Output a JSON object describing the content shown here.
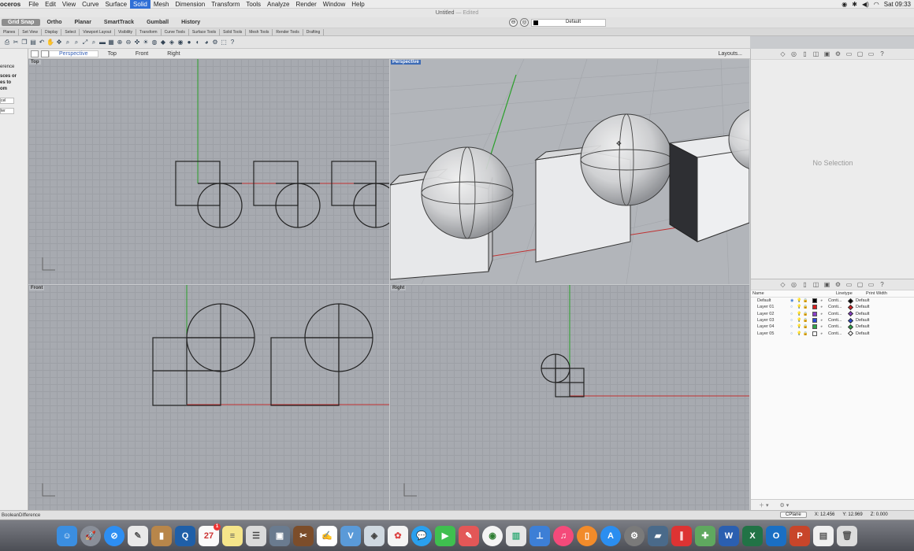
{
  "menubar": {
    "app": "oceros",
    "items": [
      "File",
      "Edit",
      "View",
      "Curve",
      "Surface",
      "Solid",
      "Mesh",
      "Dimension",
      "Transform",
      "Tools",
      "Analyze",
      "Render",
      "Window",
      "Help"
    ],
    "active_item": "Solid",
    "clock": "Sat 09:33"
  },
  "title": {
    "name": "Untitled",
    "status": "— Edited"
  },
  "snapbar": {
    "toggles": [
      "Grid Snap",
      "Ortho",
      "Planar",
      "SmartTrack",
      "Gumball",
      "History"
    ],
    "active_toggle": "Grid Snap",
    "layer": "Default"
  },
  "tabbar": {
    "tabs": [
      "Planes",
      "Set View",
      "Display",
      "Select",
      "Viewport Layout",
      "Visibility",
      "Transform",
      "Curve Tools",
      "Surface Tools",
      "Solid Tools",
      "Mesh Tools",
      "Render Tools",
      "Drafting"
    ]
  },
  "toolbar": {
    "icons": [
      "print-icon",
      "cut-icon",
      "copy-icon",
      "paste-icon",
      "undo-icon",
      "pan-icon",
      "rotate-icon",
      "zoom-icon",
      "zoom-window-icon",
      "zoom-extents-icon",
      "zoom-selected-icon",
      "shade-icon",
      "render-icon",
      "light-icon",
      "material-icon",
      "sphere-icon",
      "help-icon"
    ]
  },
  "viewport_tabs": {
    "tabs": [
      "Perspective",
      "Top",
      "Front",
      "Right"
    ],
    "active": "Perspective",
    "layouts": "Layouts..."
  },
  "left_panel": {
    "prompt_lines": [
      "erence",
      "sces or",
      "es to",
      "om"
    ],
    "option1": "cel",
    "option2": "ter"
  },
  "viewports": {
    "top": "Top",
    "perspective": "Perspective",
    "front": "Front",
    "right": "Right"
  },
  "properties": {
    "empty_text": "No Selection"
  },
  "layers": {
    "headers": {
      "name": "Name",
      "linetype": "Linetype",
      "print_width": "Print Width"
    },
    "rows": [
      {
        "name": "Default",
        "color": "#000000",
        "linetype": "Conti...",
        "print_width": "Default",
        "current": true
      },
      {
        "name": "Layer 01",
        "color": "#d92020",
        "linetype": "Conti...",
        "print_width": "Default",
        "current": false
      },
      {
        "name": "Layer 02",
        "color": "#8a3fc9",
        "linetype": "Conti...",
        "print_width": "Default",
        "current": false
      },
      {
        "name": "Layer 03",
        "color": "#2a49d6",
        "linetype": "Conti...",
        "print_width": "Default",
        "current": false
      },
      {
        "name": "Layer 04",
        "color": "#2fa54a",
        "linetype": "Conti...",
        "print_width": "Default",
        "current": false
      },
      {
        "name": "Layer 05",
        "color": "#ffffff",
        "linetype": "Conti...",
        "print_width": "Default",
        "current": false
      }
    ]
  },
  "status": {
    "command": "BooleanDifference",
    "cplane": "CPlane",
    "x": "X: 12.456",
    "y": "Y: 12.969",
    "z": "Z: 0.000"
  },
  "dock": {
    "calendar_day": "27",
    "badge_count": "1"
  }
}
